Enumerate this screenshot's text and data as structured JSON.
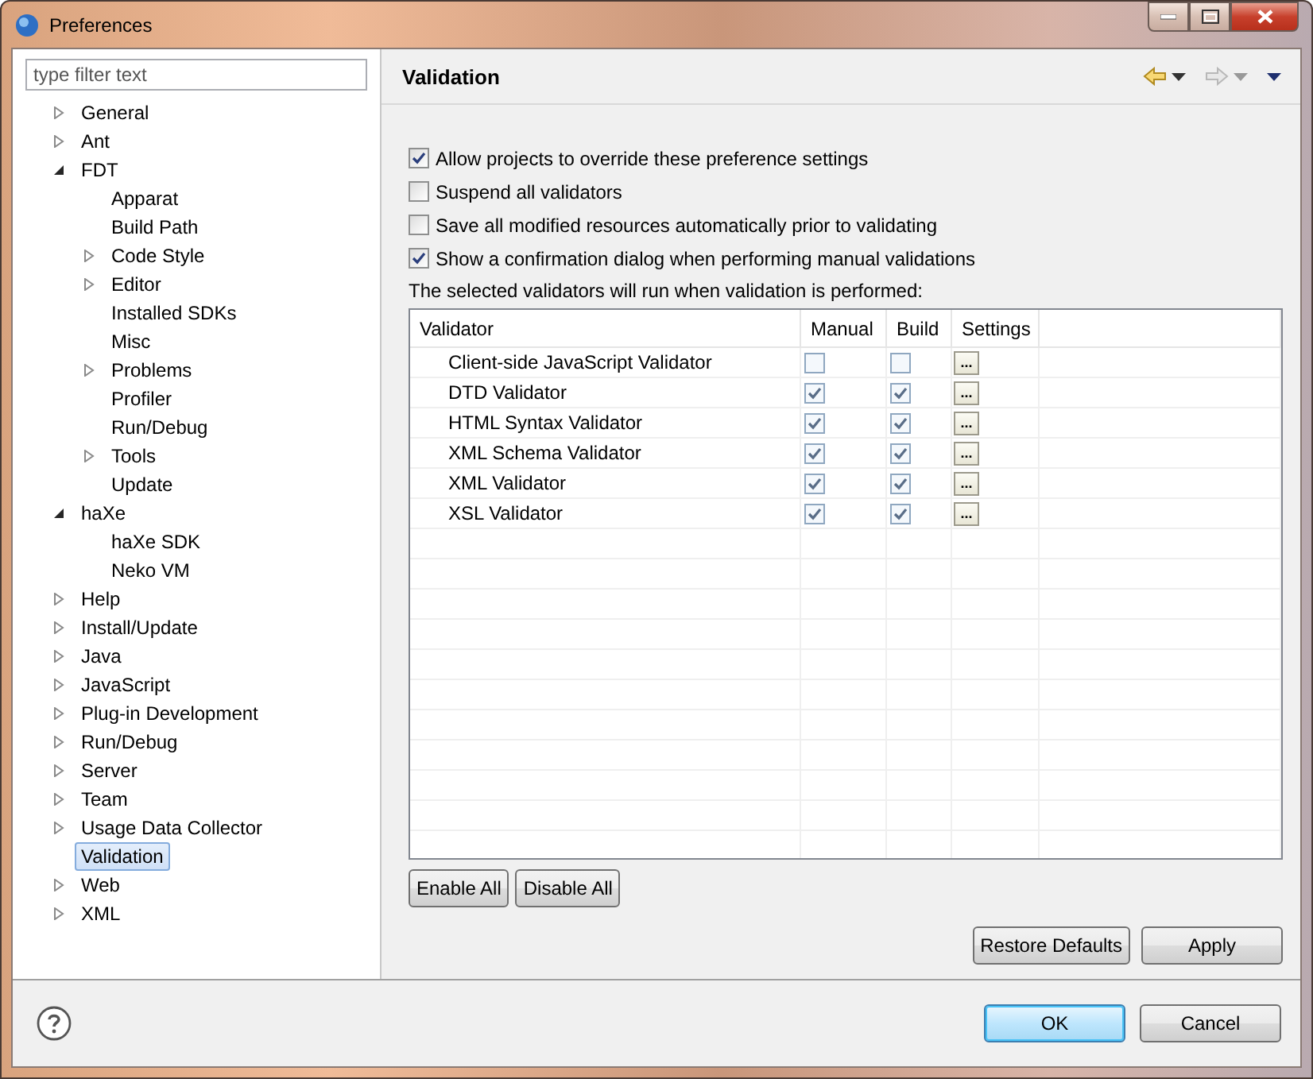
{
  "window": {
    "title": "Preferences"
  },
  "filter": {
    "placeholder": "type filter text"
  },
  "tree": [
    {
      "label": "General",
      "expanded": false,
      "selected": false
    },
    {
      "label": "Ant",
      "expanded": false,
      "selected": false
    },
    {
      "label": "FDT",
      "expanded": true,
      "selected": false,
      "children": [
        {
          "label": "Apparat",
          "selected": false
        },
        {
          "label": "Build Path",
          "selected": false
        },
        {
          "label": "Code Style",
          "expanded": false,
          "selected": false
        },
        {
          "label": "Editor",
          "expanded": false,
          "selected": false
        },
        {
          "label": "Installed SDKs",
          "selected": false
        },
        {
          "label": "Misc",
          "selected": false
        },
        {
          "label": "Problems",
          "expanded": false,
          "selected": false
        },
        {
          "label": "Profiler",
          "selected": false
        },
        {
          "label": "Run/Debug",
          "selected": false
        },
        {
          "label": "Tools",
          "expanded": false,
          "selected": false
        },
        {
          "label": "Update",
          "selected": false
        }
      ]
    },
    {
      "label": "haXe",
      "expanded": true,
      "selected": false,
      "children": [
        {
          "label": "haXe SDK",
          "selected": false
        },
        {
          "label": "Neko VM",
          "selected": false
        }
      ]
    },
    {
      "label": "Help",
      "expanded": false,
      "selected": false
    },
    {
      "label": "Install/Update",
      "expanded": false,
      "selected": false
    },
    {
      "label": "Java",
      "expanded": false,
      "selected": false
    },
    {
      "label": "JavaScript",
      "expanded": false,
      "selected": false
    },
    {
      "label": "Plug-in Development",
      "expanded": false,
      "selected": false
    },
    {
      "label": "Run/Debug",
      "expanded": false,
      "selected": false
    },
    {
      "label": "Server",
      "expanded": false,
      "selected": false
    },
    {
      "label": "Team",
      "expanded": false,
      "selected": false
    },
    {
      "label": "Usage Data Collector",
      "expanded": false,
      "selected": false
    },
    {
      "label": "Validation",
      "selected": true
    },
    {
      "label": "Web",
      "expanded": false,
      "selected": false
    },
    {
      "label": "XML",
      "expanded": false,
      "selected": false
    }
  ],
  "page": {
    "title": "Validation",
    "navigation": {
      "back": {
        "disabled": false
      },
      "forward": {
        "disabled": true
      }
    },
    "options": [
      {
        "label": "Allow projects to override these preference settings",
        "checked": true
      },
      {
        "label": "Suspend all validators",
        "checked": false
      },
      {
        "label": "Save all modified resources automatically prior to validating",
        "checked": false
      },
      {
        "label": "Show a confirmation dialog when performing manual validations",
        "checked": true
      }
    ],
    "table_caption": "The selected validators will run when validation is performed:",
    "table": {
      "columns": [
        "Validator",
        "Manual",
        "Build",
        "Settings"
      ],
      "rows": [
        {
          "name": "Client-side JavaScript Validator",
          "manual": false,
          "build": false,
          "settings": "..."
        },
        {
          "name": "DTD Validator",
          "manual": true,
          "build": true,
          "settings": "..."
        },
        {
          "name": "HTML Syntax Validator",
          "manual": true,
          "build": true,
          "settings": "..."
        },
        {
          "name": "XML Schema Validator",
          "manual": true,
          "build": true,
          "settings": "..."
        },
        {
          "name": "XML Validator",
          "manual": true,
          "build": true,
          "settings": "..."
        },
        {
          "name": "XSL Validator",
          "manual": true,
          "build": true,
          "settings": "..."
        }
      ]
    },
    "table_buttons": [
      "Enable All",
      "Disable All"
    ],
    "footer_buttons": [
      "Restore Defaults",
      "Apply"
    ]
  },
  "dialog_buttons": [
    {
      "label": "OK",
      "default": true
    },
    {
      "label": "Cancel",
      "default": false
    }
  ]
}
